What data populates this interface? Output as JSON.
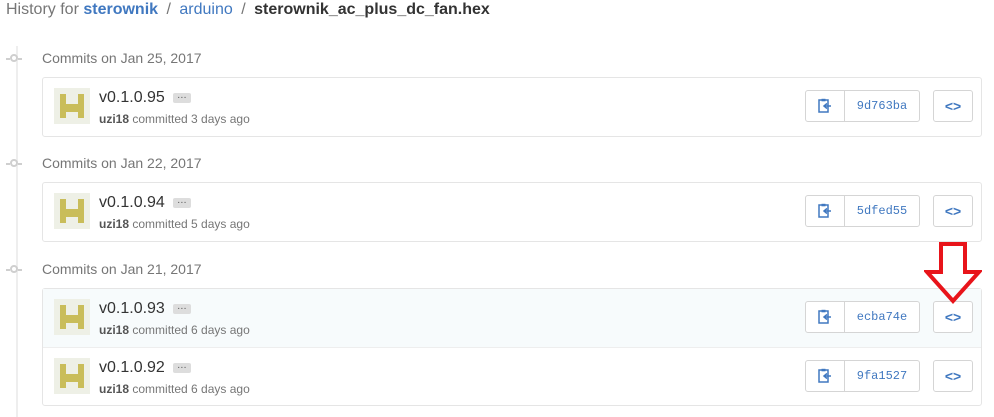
{
  "breadcrumb": {
    "prefix": "History for",
    "repo": "sterownik",
    "sep1": "/",
    "folder": "arduino",
    "sep2": "/",
    "file": "sterownik_ac_plus_dc_fan.hex"
  },
  "groups": [
    {
      "title": "Commits on Jan 25, 2017",
      "commits": [
        {
          "message": "v0.1.0.95",
          "ellipsis": "…",
          "author": "uzi18",
          "time": "committed 3 days ago",
          "sha": "9d763ba",
          "browse": "<>"
        }
      ]
    },
    {
      "title": "Commits on Jan 22, 2017",
      "commits": [
        {
          "message": "v0.1.0.94",
          "ellipsis": "…",
          "author": "uzi18",
          "time": "committed 5 days ago",
          "sha": "5dfed55",
          "browse": "<>"
        }
      ]
    },
    {
      "title": "Commits on Jan 21, 2017",
      "commits": [
        {
          "message": "v0.1.0.93",
          "ellipsis": "…",
          "author": "uzi18",
          "time": "committed 6 days ago",
          "sha": "ecba74e",
          "browse": "<>"
        },
        {
          "message": "v0.1.0.92",
          "ellipsis": "…",
          "author": "uzi18",
          "time": "committed 6 days ago",
          "sha": "9fa1527",
          "browse": "<>"
        }
      ]
    }
  ],
  "icons": {
    "copy": "clippy-icon",
    "browse": "code-icon",
    "annotation": "down-arrow-icon",
    "timeline": "commit-dot-icon"
  },
  "colors": {
    "link": "#4078c0",
    "annotation": "#e8141a",
    "avatar": "#c9bd5a"
  }
}
